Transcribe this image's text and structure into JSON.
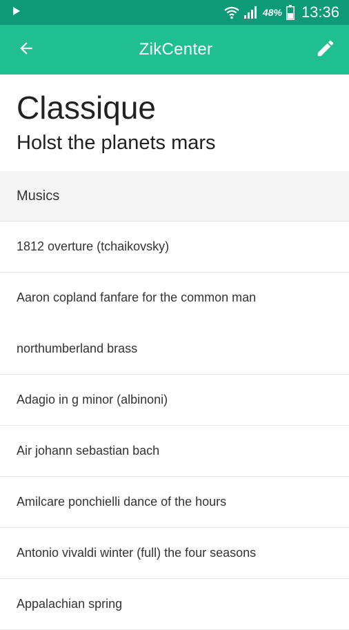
{
  "status_bar": {
    "battery_percent": "48%",
    "time": "13:36",
    "icons": [
      "play-icon",
      "wifi-icon",
      "signal-icon",
      "battery-icon"
    ]
  },
  "app_bar": {
    "title": "ZikCenter",
    "back_icon": "arrow-left-icon",
    "edit_icon": "pencil-icon",
    "background_color": "#20bf91",
    "status_color": "#0c9b76"
  },
  "playlist": {
    "title": "Classique",
    "subtitle": "Holst the planets mars"
  },
  "section": {
    "header": "Musics"
  },
  "tracks": [
    "1812 overture (tchaikovsky)",
    "Aaron copland fanfare for the common man",
    "northumberland brass",
    "Adagio in g minor (albinoni)",
    "Air johann sebastian bach",
    "Amilcare ponchielli dance of the hours",
    "Antonio vivaldi winter (full) the four seasons",
    "Appalachian spring"
  ]
}
